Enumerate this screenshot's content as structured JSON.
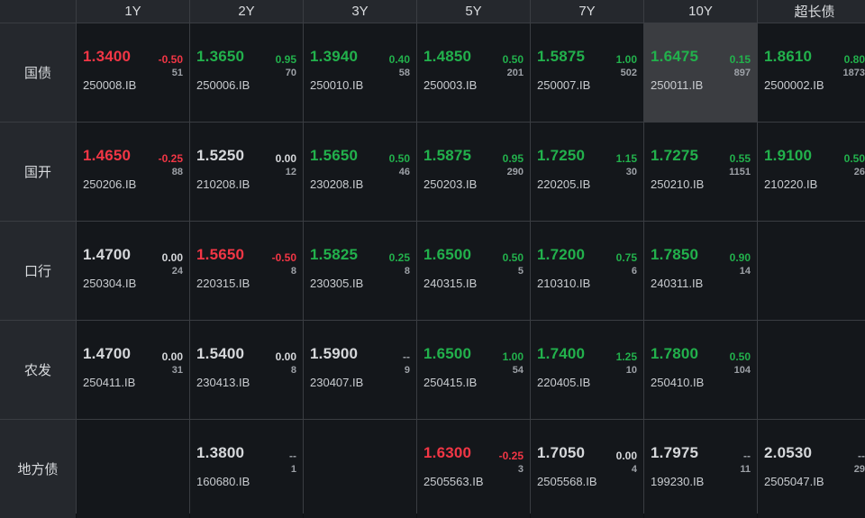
{
  "colors": {
    "up": "#22b14c",
    "down": "#f23645",
    "flat": "#d6d8db"
  },
  "columns": [
    "1Y",
    "2Y",
    "3Y",
    "5Y",
    "7Y",
    "10Y",
    "超长债"
  ],
  "rows": [
    {
      "label": "国债",
      "cells": [
        {
          "yield": "1.3400",
          "change": "-0.50",
          "volume": "51",
          "code": "250008.IB",
          "trend": "down"
        },
        {
          "yield": "1.3650",
          "change": "0.95",
          "volume": "70",
          "code": "250006.IB",
          "trend": "up"
        },
        {
          "yield": "1.3940",
          "change": "0.40",
          "volume": "58",
          "code": "250010.IB",
          "trend": "up"
        },
        {
          "yield": "1.4850",
          "change": "0.50",
          "volume": "201",
          "code": "250003.IB",
          "trend": "up"
        },
        {
          "yield": "1.5875",
          "change": "1.00",
          "volume": "502",
          "code": "250007.IB",
          "trend": "up"
        },
        {
          "yield": "1.6475",
          "change": "0.15",
          "volume": "897",
          "code": "250011.IB",
          "trend": "up",
          "selected": true
        },
        {
          "yield": "1.8610",
          "change": "0.80",
          "volume": "1873",
          "code": "2500002.IB",
          "trend": "up"
        }
      ]
    },
    {
      "label": "国开",
      "cells": [
        {
          "yield": "1.4650",
          "change": "-0.25",
          "volume": "88",
          "code": "250206.IB",
          "trend": "down"
        },
        {
          "yield": "1.5250",
          "change": "0.00",
          "volume": "12",
          "code": "210208.IB",
          "trend": "flat"
        },
        {
          "yield": "1.5650",
          "change": "0.50",
          "volume": "46",
          "code": "230208.IB",
          "trend": "up"
        },
        {
          "yield": "1.5875",
          "change": "0.95",
          "volume": "290",
          "code": "250203.IB",
          "trend": "up"
        },
        {
          "yield": "1.7250",
          "change": "1.15",
          "volume": "30",
          "code": "220205.IB",
          "trend": "up"
        },
        {
          "yield": "1.7275",
          "change": "0.55",
          "volume": "1151",
          "code": "250210.IB",
          "trend": "up"
        },
        {
          "yield": "1.9100",
          "change": "0.50",
          "volume": "26",
          "code": "210220.IB",
          "trend": "up"
        }
      ]
    },
    {
      "label": "口行",
      "cells": [
        {
          "yield": "1.4700",
          "change": "0.00",
          "volume": "24",
          "code": "250304.IB",
          "trend": "flat"
        },
        {
          "yield": "1.5650",
          "change": "-0.50",
          "volume": "8",
          "code": "220315.IB",
          "trend": "down"
        },
        {
          "yield": "1.5825",
          "change": "0.25",
          "volume": "8",
          "code": "230305.IB",
          "trend": "up"
        },
        {
          "yield": "1.6500",
          "change": "0.50",
          "volume": "5",
          "code": "240315.IB",
          "trend": "up"
        },
        {
          "yield": "1.7200",
          "change": "0.75",
          "volume": "6",
          "code": "210310.IB",
          "trend": "up"
        },
        {
          "yield": "1.7850",
          "change": "0.90",
          "volume": "14",
          "code": "240311.IB",
          "trend": "up"
        },
        null
      ]
    },
    {
      "label": "农发",
      "cells": [
        {
          "yield": "1.4700",
          "change": "0.00",
          "volume": "31",
          "code": "250411.IB",
          "trend": "flat"
        },
        {
          "yield": "1.5400",
          "change": "0.00",
          "volume": "8",
          "code": "230413.IB",
          "trend": "flat"
        },
        {
          "yield": "1.5900",
          "change": "--",
          "volume": "9",
          "code": "230407.IB",
          "trend": "flat"
        },
        {
          "yield": "1.6500",
          "change": "1.00",
          "volume": "54",
          "code": "250415.IB",
          "trend": "up"
        },
        {
          "yield": "1.7400",
          "change": "1.25",
          "volume": "10",
          "code": "220405.IB",
          "trend": "up"
        },
        {
          "yield": "1.7800",
          "change": "0.50",
          "volume": "104",
          "code": "250410.IB",
          "trend": "up"
        },
        null
      ]
    },
    {
      "label": "地方债",
      "cells": [
        null,
        {
          "yield": "1.3800",
          "change": "--",
          "volume": "1",
          "code": "160680.IB",
          "trend": "flat"
        },
        null,
        {
          "yield": "1.6300",
          "change": "-0.25",
          "volume": "3",
          "code": "2505563.IB",
          "trend": "down"
        },
        {
          "yield": "1.7050",
          "change": "0.00",
          "volume": "4",
          "code": "2505568.IB",
          "trend": "flat"
        },
        {
          "yield": "1.7975",
          "change": "--",
          "volume": "11",
          "code": "199230.IB",
          "trend": "flat"
        },
        {
          "yield": "2.0530",
          "change": "--",
          "volume": "29",
          "code": "2505047.IB",
          "trend": "flat"
        }
      ]
    }
  ]
}
